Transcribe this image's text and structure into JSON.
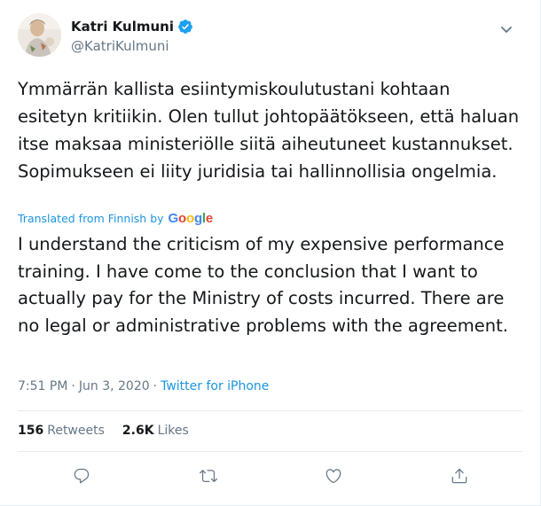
{
  "user": {
    "display_name": "Katri Kulmuni",
    "handle": "@KatriKulmuni",
    "verified": true,
    "avatar_icon": "profile-photo"
  },
  "tweet": {
    "original_text": "Ymmärrän kallista esiintymiskoulutustani kohtaan esitetyn kritiikin. Olen tullut johtopäätökseen, että haluan itse maksaa ministeriölle siitä aiheutuneet kustannukset. Sopimukseen ei liity juridisia tai hallinnollisia ongelmia.",
    "translated_label": "Translated from Finnish by",
    "translation_provider": "Google",
    "translated_text": "I understand the criticism of my expensive performance training. I have come to the conclusion that I want to actually pay for the Ministry of costs incurred. There are no legal or administrative problems with the agreement."
  },
  "meta": {
    "time": "7:51 PM",
    "separator": "·",
    "date": "Jun 3, 2020",
    "source": "Twitter for iPhone"
  },
  "stats": {
    "retweets_count": "156",
    "retweets_label": "Retweets",
    "likes_count": "2.6K",
    "likes_label": "Likes"
  },
  "actions": [
    "reply-icon",
    "retweet-icon",
    "like-icon",
    "share-icon"
  ],
  "colors": {
    "accent": "#1b95e0",
    "verified": "#1da1f2",
    "secondary_text": "#657786",
    "divider": "#e6ecf0"
  }
}
